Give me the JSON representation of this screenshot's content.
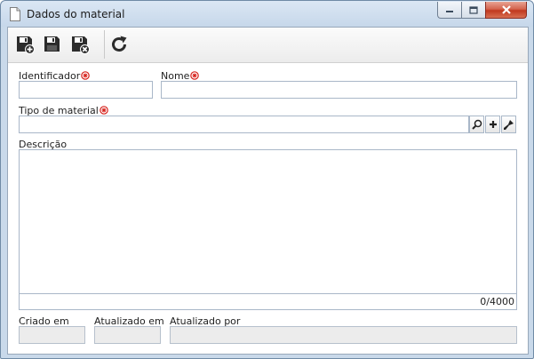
{
  "window": {
    "title": "Dados do material",
    "controls": [
      "minimize-icon",
      "maximize-icon",
      "close-icon"
    ]
  },
  "toolbar": {
    "buttons": [
      {
        "name": "save-new",
        "icon": "floppy-disk-plus-icon"
      },
      {
        "name": "save",
        "icon": "floppy-disk-icon"
      },
      {
        "name": "save-close",
        "icon": "floppy-disk-x-icon"
      },
      {
        "name": "refresh",
        "icon": "refresh-icon"
      }
    ]
  },
  "form": {
    "identifier": {
      "label": "Identificador",
      "value": "",
      "required": true
    },
    "name": {
      "label": "Nome",
      "value": "",
      "required": true
    },
    "material_type": {
      "label": "Tipo de material",
      "value": "",
      "required": true,
      "actions": [
        "search-icon",
        "plus-icon",
        "clear-icon"
      ]
    },
    "description": {
      "label": "Descrição",
      "value": "",
      "counter": "0/4000"
    },
    "created_on": {
      "label": "Criado em",
      "value": ""
    },
    "updated_on": {
      "label": "Atualizado em",
      "value": ""
    },
    "updated_by": {
      "label": "Atualizado por",
      "value": ""
    }
  },
  "colors": {
    "required_marker": "#d6221c",
    "title_bar": "#c9d9ea",
    "close_button": "#c7432a"
  }
}
